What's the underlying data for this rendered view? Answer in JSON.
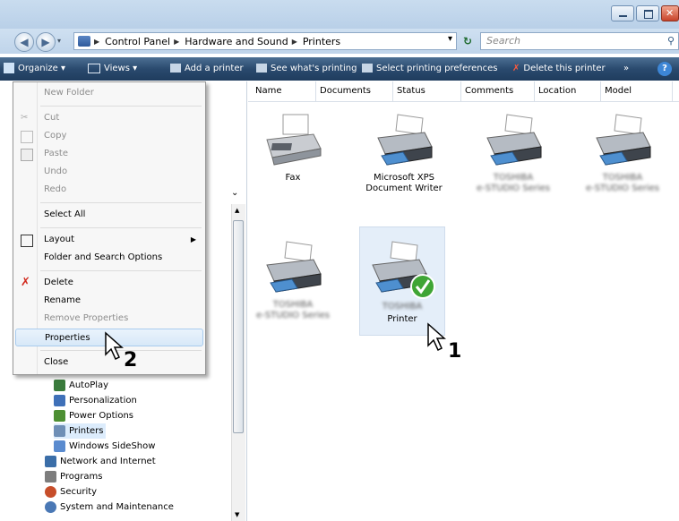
{
  "window": {
    "buttons": {
      "minimize": "–",
      "maximize": "□",
      "close": "✕"
    }
  },
  "address": {
    "back_icon": "back-arrow-icon",
    "forward_icon": "forward-arrow-icon",
    "crumbs": [
      "Control Panel",
      "Hardware and Sound",
      "Printers"
    ],
    "dropdown": "▾",
    "refresh": "↻",
    "search_placeholder": "Search"
  },
  "toolbar": {
    "organize": "Organize",
    "views": "Views",
    "add_printer": "Add a printer",
    "see_printing": "See what's printing",
    "select_prefs": "Select printing preferences",
    "delete_printer": "Delete this printer",
    "more": "»",
    "help": "?"
  },
  "columns": [
    "Name",
    "Documents",
    "Status",
    "Comments",
    "Location",
    "Model"
  ],
  "menu": {
    "new_folder": "New Folder",
    "cut": "Cut",
    "copy": "Copy",
    "paste": "Paste",
    "undo": "Undo",
    "redo": "Redo",
    "select_all": "Select All",
    "layout": "Layout",
    "folder_options": "Folder and Search Options",
    "delete": "Delete",
    "rename": "Rename",
    "remove_properties": "Remove Properties",
    "properties": "Properties",
    "close": "Close"
  },
  "tree": {
    "autoplay": "AutoPlay",
    "personalization": "Personalization",
    "power": "Power Options",
    "printers": "Printers",
    "sideshow": "Windows SideShow",
    "network": "Network and Internet",
    "programs": "Programs",
    "security": "Security",
    "system": "System and Maintenance"
  },
  "devices": {
    "fax": "Fax",
    "xps": "Microsoft XPS Document Writer",
    "printer": "Printer",
    "blurred_line1": "TOSHIBA",
    "blurred_line2": "e-STUDIO Series"
  },
  "annotations": {
    "step1": "1",
    "step2": "2"
  },
  "colors": {
    "accent": "#2a4a6e",
    "check": "#3fa535",
    "delete_x": "#d12a1e"
  }
}
